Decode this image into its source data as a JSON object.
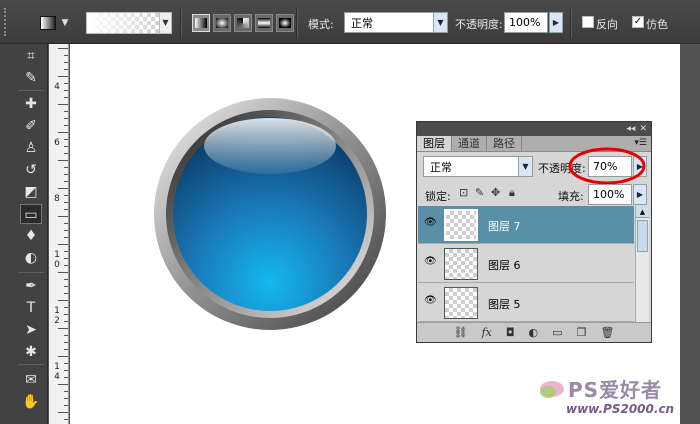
{
  "options_bar": {
    "mode_label": "模式:",
    "mode_value": "正常",
    "opacity_label": "不透明度:",
    "opacity_value": "100%",
    "reverse_label": "反向",
    "reverse_checked": false,
    "dither_label": "仿色",
    "dither_checked": true
  },
  "ruler": {
    "labels": [
      "4",
      "6",
      "8",
      "1\n0",
      "1\n2",
      "1\n4"
    ]
  },
  "layers_panel": {
    "tabs": [
      "图层",
      "通道",
      "路径"
    ],
    "active_tab": 0,
    "blend_mode": "正常",
    "opacity_label": "不透明度:",
    "opacity_value": "70%",
    "lock_label": "锁定:",
    "fill_label": "填充:",
    "fill_value": "100%",
    "layers": [
      {
        "name": "图层 7",
        "selected": true,
        "visible": true
      },
      {
        "name": "图层 6",
        "selected": false,
        "visible": true
      },
      {
        "name": "图层 5",
        "selected": false,
        "visible": true
      }
    ],
    "footer_icons": [
      "link-icon",
      "fx-icon",
      "mask-icon",
      "adjustment-icon",
      "folder-icon",
      "new-layer-icon",
      "trash-icon"
    ]
  },
  "watermark": {
    "brand": "PS爱好者",
    "url": "www.PS2000.cn"
  },
  "colors": {
    "highlight_circle": "#e00000",
    "orb_blue": "#1a78b8",
    "selected_layer": "#5a8fa8"
  }
}
